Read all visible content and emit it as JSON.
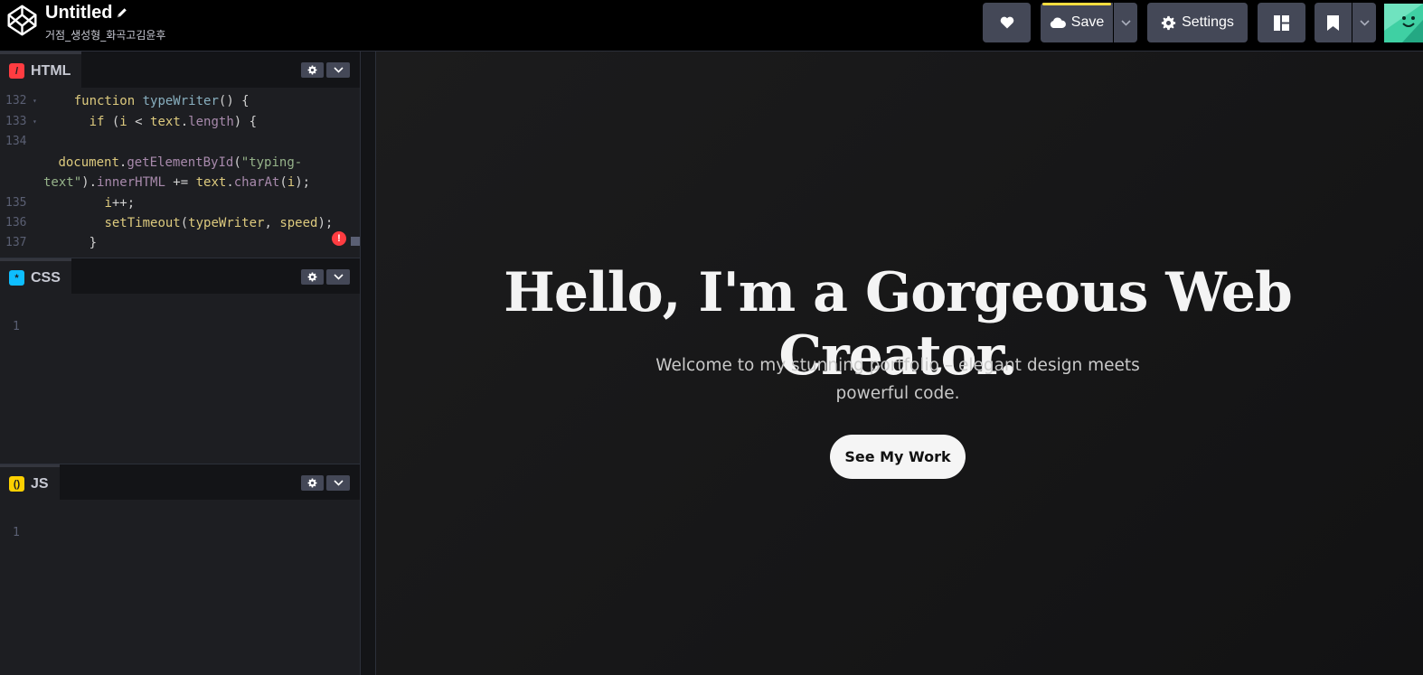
{
  "header": {
    "pen_title": "Untitled",
    "pen_user": "거점_생성형_화곡고김윤후",
    "save_label": "Save",
    "settings_label": "Settings",
    "accent_color": "#ffdd40"
  },
  "editors": {
    "html": {
      "label": "HTML",
      "lines": [
        {
          "num": "132",
          "fold": "▾",
          "code": [
            {
              "t": "    ",
              "c": "plain"
            },
            {
              "t": "function",
              "c": "kw"
            },
            {
              "t": " ",
              "c": "plain"
            },
            {
              "t": "typeWriter",
              "c": "fn"
            },
            {
              "t": "() {",
              "c": "plain"
            }
          ]
        },
        {
          "num": "133",
          "fold": "▾",
          "code": [
            {
              "t": "      ",
              "c": "plain"
            },
            {
              "t": "if",
              "c": "kw"
            },
            {
              "t": " (",
              "c": "plain"
            },
            {
              "t": "i",
              "c": "kw"
            },
            {
              "t": " < ",
              "c": "plain"
            },
            {
              "t": "text",
              "c": "kw"
            },
            {
              "t": ".",
              "c": "plain"
            },
            {
              "t": "length",
              "c": "prop"
            },
            {
              "t": ") {",
              "c": "plain"
            }
          ]
        },
        {
          "num": "134",
          "fold": "",
          "code": []
        },
        {
          "num": "",
          "fold": "",
          "code": [
            {
              "t": " ",
              "c": "plain"
            },
            {
              "t": "document",
              "c": "kw"
            },
            {
              "t": ".",
              "c": "plain"
            },
            {
              "t": "getElementById",
              "c": "prop"
            },
            {
              "t": "(",
              "c": "plain"
            },
            {
              "t": "\"typing-",
              "c": "str"
            }
          ]
        },
        {
          "num": "",
          "fold": "",
          "code": [
            {
              "t": "text\"",
              "c": "str"
            },
            {
              "t": ").",
              "c": "plain"
            },
            {
              "t": "innerHTML",
              "c": "prop"
            },
            {
              "t": " += ",
              "c": "plain"
            },
            {
              "t": "text",
              "c": "kw"
            },
            {
              "t": ".",
              "c": "plain"
            },
            {
              "t": "charAt",
              "c": "prop"
            },
            {
              "t": "(",
              "c": "plain"
            },
            {
              "t": "i",
              "c": "kw"
            },
            {
              "t": ");",
              "c": "plain"
            }
          ]
        },
        {
          "num": "135",
          "fold": "",
          "code": [
            {
              "t": "        ",
              "c": "plain"
            },
            {
              "t": "i",
              "c": "kw"
            },
            {
              "t": "++;",
              "c": "plain"
            }
          ]
        },
        {
          "num": "136",
          "fold": "",
          "code": [
            {
              "t": "        ",
              "c": "plain"
            },
            {
              "t": "setTimeout",
              "c": "kw"
            },
            {
              "t": "(",
              "c": "plain"
            },
            {
              "t": "typeWriter",
              "c": "kw"
            },
            {
              "t": ", ",
              "c": "plain"
            },
            {
              "t": "speed",
              "c": "kw"
            },
            {
              "t": ");",
              "c": "plain"
            }
          ]
        },
        {
          "num": "137",
          "fold": "",
          "code": [
            {
              "t": "      }",
              "c": "plain"
            }
          ]
        }
      ],
      "error_badge": "!"
    },
    "css": {
      "label": "CSS",
      "lines": [
        {
          "num": "1"
        }
      ]
    },
    "js": {
      "label": "JS",
      "lines": [
        {
          "num": "1"
        }
      ]
    }
  },
  "preview": {
    "title": "Hello, I'm a Gorgeous Web Creator.",
    "subtitle": "Welcome to my stunning portfolio – elegant design meets powerful code.",
    "cta_label": "See My Work"
  }
}
